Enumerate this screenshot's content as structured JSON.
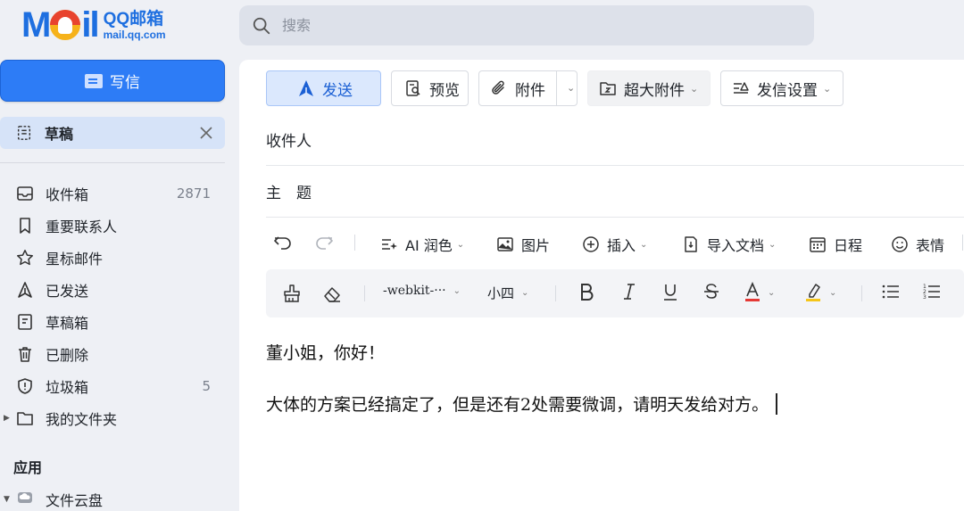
{
  "logo": {
    "word_left": "M",
    "word_right": "il",
    "name": "QQ邮箱",
    "url": "mail.qq.com"
  },
  "search": {
    "placeholder": "搜索"
  },
  "sidebar": {
    "compose_label": "写信",
    "active_tab": {
      "label": "草稿"
    },
    "folders": [
      {
        "label": "收件箱",
        "count": "2871",
        "icon": "inbox-icon"
      },
      {
        "label": "重要联系人",
        "count": "",
        "icon": "bookmark-icon"
      },
      {
        "label": "星标邮件",
        "count": "",
        "icon": "star-icon"
      },
      {
        "label": "已发送",
        "count": "",
        "icon": "sent-icon"
      },
      {
        "label": "草稿箱",
        "count": "",
        "icon": "draft-icon"
      },
      {
        "label": "已删除",
        "count": "",
        "icon": "trash-icon"
      },
      {
        "label": "垃圾箱",
        "count": "5",
        "icon": "shield-icon"
      },
      {
        "label": "我的文件夹",
        "count": "",
        "icon": "folder-icon"
      }
    ],
    "apps_heading": "应用",
    "apps": [
      {
        "label": "文件云盘",
        "icon": "cloud-disk-icon"
      }
    ]
  },
  "compose": {
    "buttons": {
      "send": "发送",
      "preview": "预览",
      "attach": "附件",
      "big_attach": "超大附件",
      "send_settings": "发信设置"
    },
    "to_label": "收件人",
    "subject_label": "主　题",
    "toolbar": {
      "ai_polish": "AI 润色",
      "image": "图片",
      "insert": "插入",
      "import_doc": "导入文档",
      "schedule": "日程",
      "emoji": "表情"
    },
    "format": {
      "font_family": "-webkit-···",
      "font_size": "小四"
    },
    "body": [
      "董小姐，你好！",
      "大体的方案已经搞定了，但是还有2处需要微调，请明天发给对方。"
    ]
  },
  "colors": {
    "accent": "#2d7cf6",
    "send_bg": "#dbe8fd",
    "font_color_bar": "#e53935",
    "highlight_bar": "#f5c518"
  }
}
